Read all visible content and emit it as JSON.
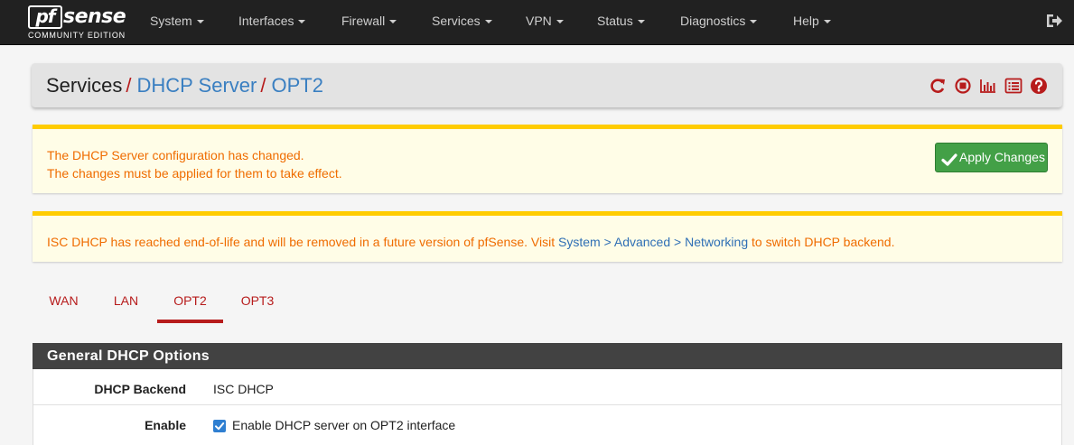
{
  "brand": {
    "logo_pf": "pf",
    "logo_sense": "sense",
    "edition": "COMMUNITY EDITION"
  },
  "nav": {
    "items": [
      {
        "label": "System"
      },
      {
        "label": "Interfaces"
      },
      {
        "label": "Firewall"
      },
      {
        "label": "Services"
      },
      {
        "label": "VPN"
      },
      {
        "label": "Status"
      },
      {
        "label": "Diagnostics"
      },
      {
        "label": "Help"
      }
    ],
    "logout_icon": "sign-out-icon"
  },
  "breadcrumb": {
    "root": "Services",
    "separator": "/",
    "section": "DHCP Server",
    "current": "OPT2",
    "icons": [
      "restart-icon",
      "stop-icon",
      "chart-icon",
      "log-icon",
      "help-icon"
    ]
  },
  "alert_changes": {
    "line1": "The DHCP Server configuration has changed.",
    "line2": "The changes must be applied for them to take effect.",
    "apply_label": "Apply Changes"
  },
  "alert_eol": {
    "text_before": "ISC DHCP has reached end-of-life and will be removed in a future version of pfSense. Visit ",
    "link_text": "System > Advanced > Networking",
    "text_after": " to switch DHCP backend."
  },
  "tabs": [
    {
      "label": "WAN",
      "active": false
    },
    {
      "label": "LAN",
      "active": false
    },
    {
      "label": "OPT2",
      "active": true
    },
    {
      "label": "OPT3",
      "active": false
    }
  ],
  "panel": {
    "title": "General DHCP Options",
    "rows": {
      "backend": {
        "label": "DHCP Backend",
        "value": "ISC DHCP"
      },
      "enable": {
        "label": "Enable",
        "checkbox_label": "Enable DHCP server on OPT2 interface",
        "checked": true
      }
    }
  },
  "colors": {
    "navbar": "#212121",
    "accent_red": "#b71c1c",
    "link_blue": "#3a7fc1",
    "alert_text": "#ef6c00",
    "alert_border": "#ffcc00",
    "apply_green": "#43a047",
    "panel_header": "#424242"
  }
}
